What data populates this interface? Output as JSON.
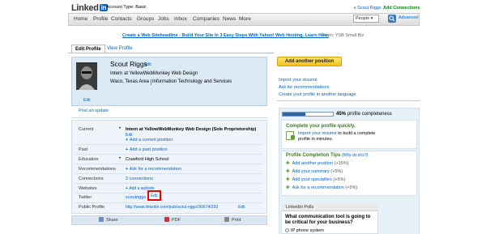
{
  "header": {
    "logo_text": "Linked",
    "logo_in": "in",
    "account_type": "Account Type: Basic",
    "user_name": "Scout Riggs",
    "add_connections": "Add Connections"
  },
  "nav": {
    "items": [
      "Home",
      "Profile",
      "Contacts",
      "Groups",
      "Jobs",
      "Inbox",
      "Companies",
      "News",
      "More"
    ],
    "search_scope": "People",
    "search_value": "",
    "advanced": "Advanced"
  },
  "ad": {
    "text": "Create a Web Siteheadline - Build Your Site In 3 Easy Steps With Yahoo! Web Hosting. Learn How.",
    "source": "From:  YSB Small Biz"
  },
  "tabs": {
    "edit": "Edit Profile",
    "view": "View Profile"
  },
  "profile": {
    "name": "Scout Riggs",
    "name_edit": "Edit",
    "headline": "Intern at YellowWebMonkey Web Design",
    "location": "Waco, Texas Area",
    "industry": "Information Technology and Services",
    "avatar_edit": "Edit",
    "post_update": "Post an update"
  },
  "details": {
    "current_label": "Current",
    "current_value": "Intern at YellowWebMonkey Web Design (Sole Proprietorship)",
    "current_edit": "Edit",
    "current_add": "Add a current position",
    "past_label": "Past",
    "past_add": "Add a past position",
    "education_label": "Education",
    "education_value": "Crawford High School",
    "recommendations_label": "Recommendations",
    "recommendations_add": "Ask for a recommendation",
    "connections_label": "Connections",
    "connections_value": "2 connections",
    "websites_label": "Websites",
    "websites_add": "Add a website",
    "twitter_label": "Twitter",
    "twitter_value": "scoutriggs",
    "twitter_edit": "Edit",
    "public_label": "Public Profile",
    "public_value": "http://www.linkedin.com/pub/scout-riggs/36/674/293",
    "public_edit": "Edit"
  },
  "share_bar": {
    "share": "Share",
    "pdf": "PDF",
    "print": "Print"
  },
  "right": {
    "add_position": "Add another position",
    "links": [
      "Import your résumé",
      "Ask for recommendations",
      "Create your profile in another language"
    ],
    "progress_value": 0.45,
    "progress_pct": "45%",
    "progress_label": "profile completeness",
    "complete_title": "Complete your profile quickly.",
    "resume_link": "Import your résumé",
    "resume_rest": " to build a complete profile in minutes.",
    "tips_title": "Profile Completion Tips",
    "tips_why": "(Why do this?)",
    "tips": [
      {
        "label": "Add another position",
        "pct": "(+15%)"
      },
      {
        "label": "Add your summary",
        "pct": "(+5%)"
      },
      {
        "label": "Add your specialties",
        "pct": "(+5%)"
      },
      {
        "label": "Ask for a recommendation",
        "pct": "(+5%)"
      }
    ],
    "polls_header": "LinkedIn Polls",
    "polls_question": "What communication tool is going to be critical for your business?",
    "polls_option": "IP phone system"
  },
  "colors": {
    "brand_blue": "#0a66c2",
    "link": "#0066cc",
    "highlight": "#ee0000",
    "button_yellow": "#f4c21a"
  }
}
